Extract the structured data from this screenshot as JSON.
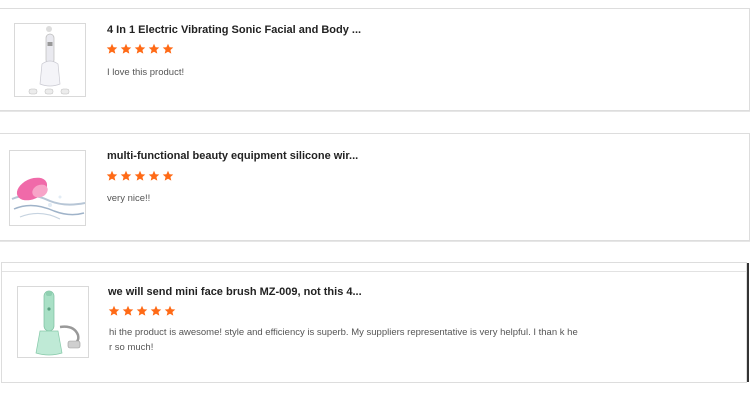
{
  "colors": {
    "star": "#ff6a16",
    "title": "#222222",
    "comment": "#555555",
    "border": "#dddddd"
  },
  "reviews": [
    {
      "product_title": "4 In 1 Electric Vibrating Sonic Facial and Body ...",
      "rating": 5,
      "comment": "I love this product!",
      "image_icon": "facial-brush-device-image"
    },
    {
      "product_title": "multi-functional beauty equipment silicone wir...",
      "rating": 5,
      "comment": "very nice!!",
      "image_icon": "silicone-brush-image"
    },
    {
      "product_title": "we will send mini face brush MZ-009, not this 4...",
      "rating": 5,
      "comment": "hi the product is awesome! style and efficiency is superb. My suppliers representative is very helpful. I than k her so much!",
      "image_icon": "mini-face-brush-image"
    }
  ]
}
